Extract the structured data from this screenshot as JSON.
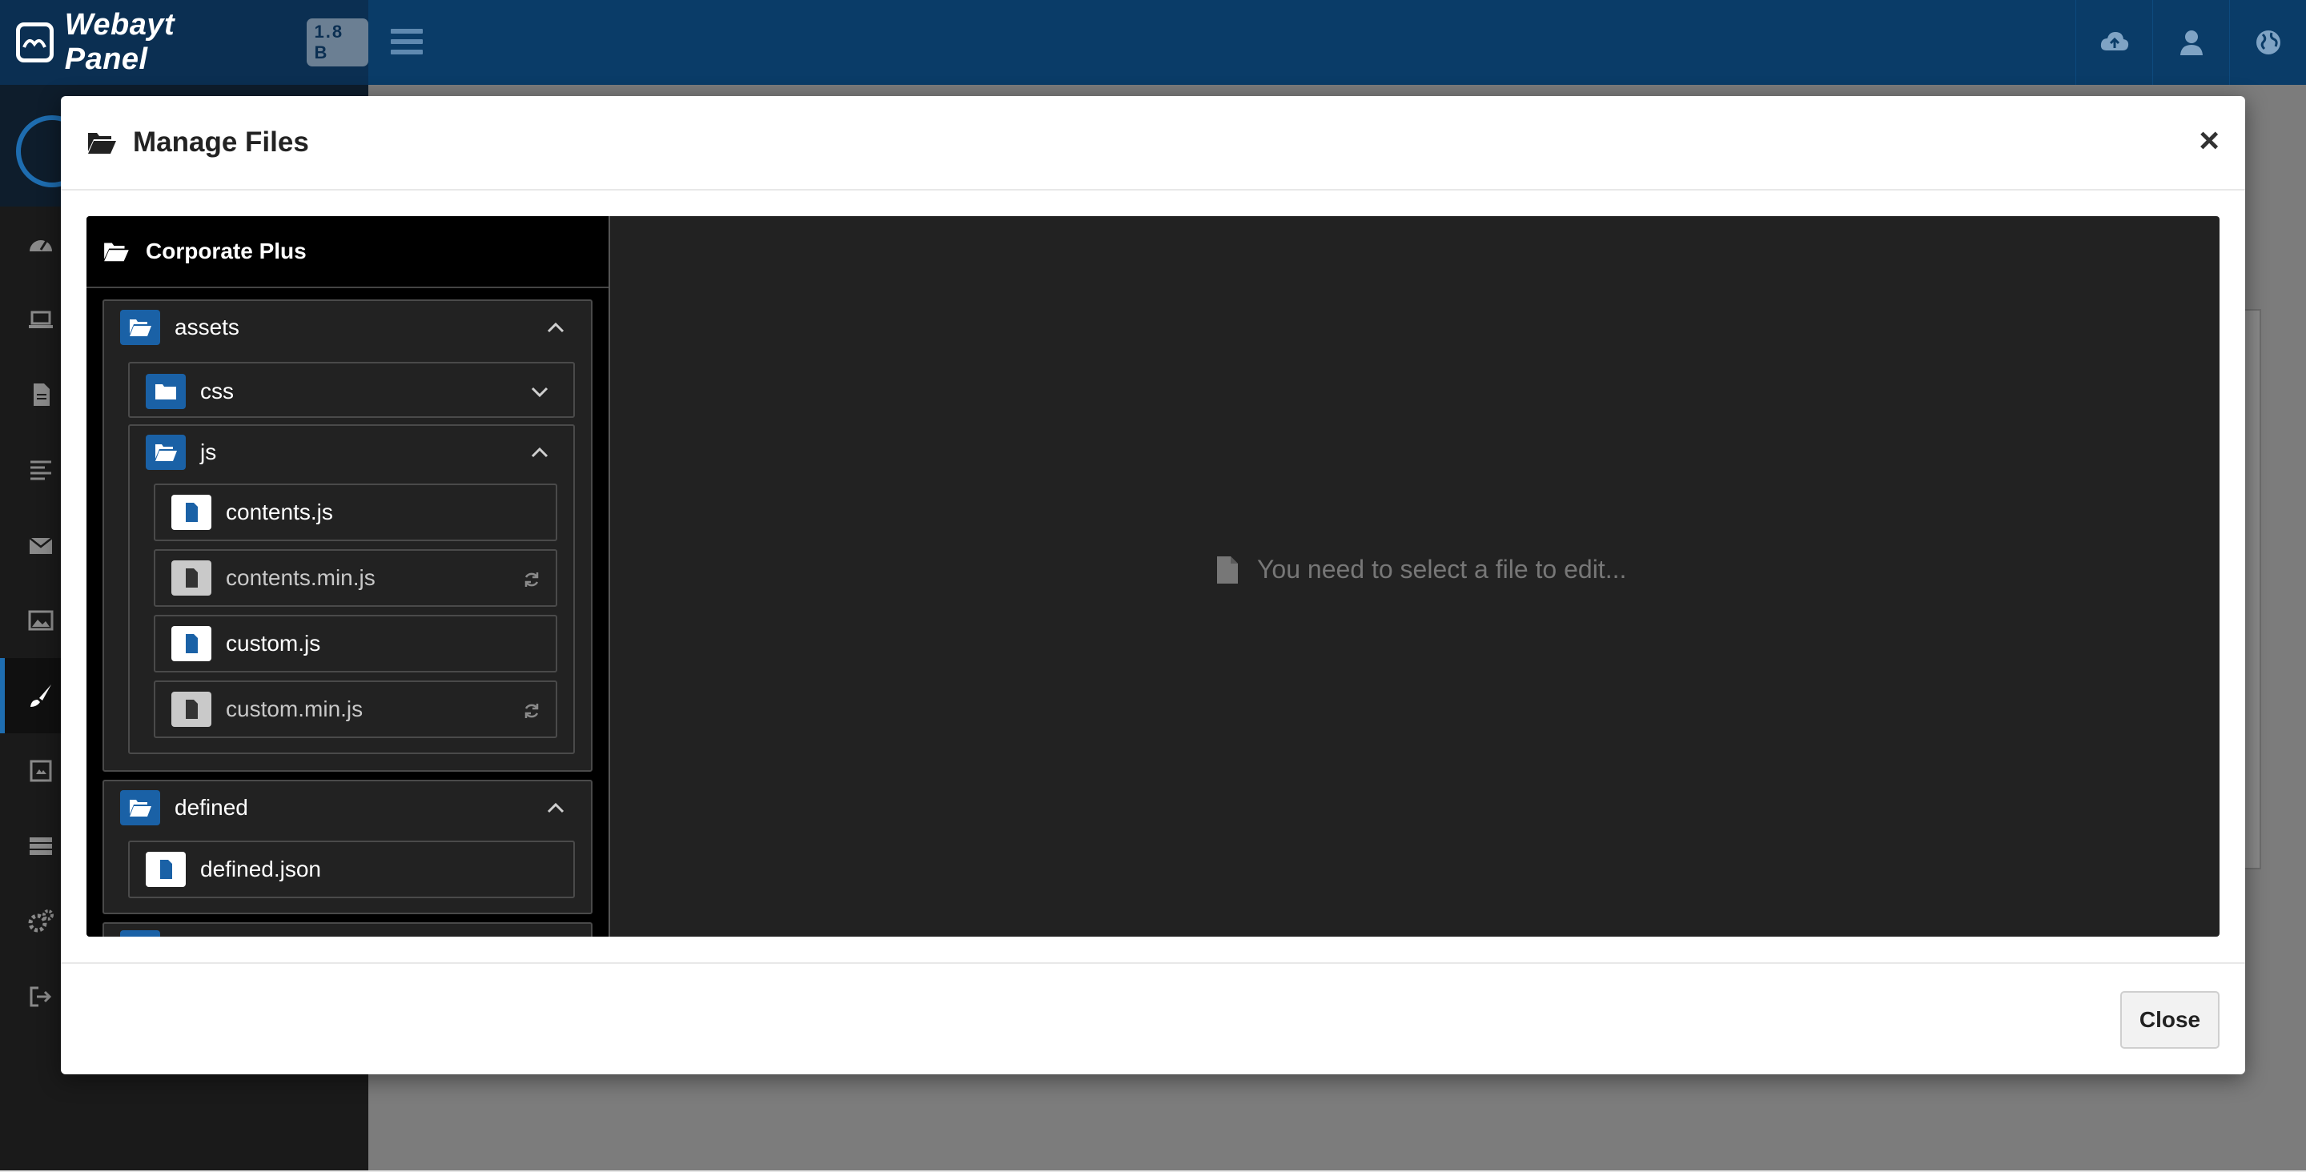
{
  "app": {
    "name": "Webayt Panel",
    "version": "1.8 B"
  },
  "modal": {
    "title": "Manage Files",
    "close_x": "×",
    "close_label": "Close",
    "empty_message": "You need to select a file to edit..."
  },
  "tree": {
    "root": "Corporate Plus",
    "assets": {
      "label": "assets",
      "css": "css",
      "js": "js",
      "files": [
        "contents.js",
        "contents.min.js",
        "custom.js",
        "custom.min.js"
      ]
    },
    "defined": {
      "label": "defined",
      "files": [
        "defined.json"
      ]
    }
  },
  "colors": {
    "accent": "#1a61a6",
    "topbar": "#0a3c68",
    "editor_bg": "#222222"
  }
}
